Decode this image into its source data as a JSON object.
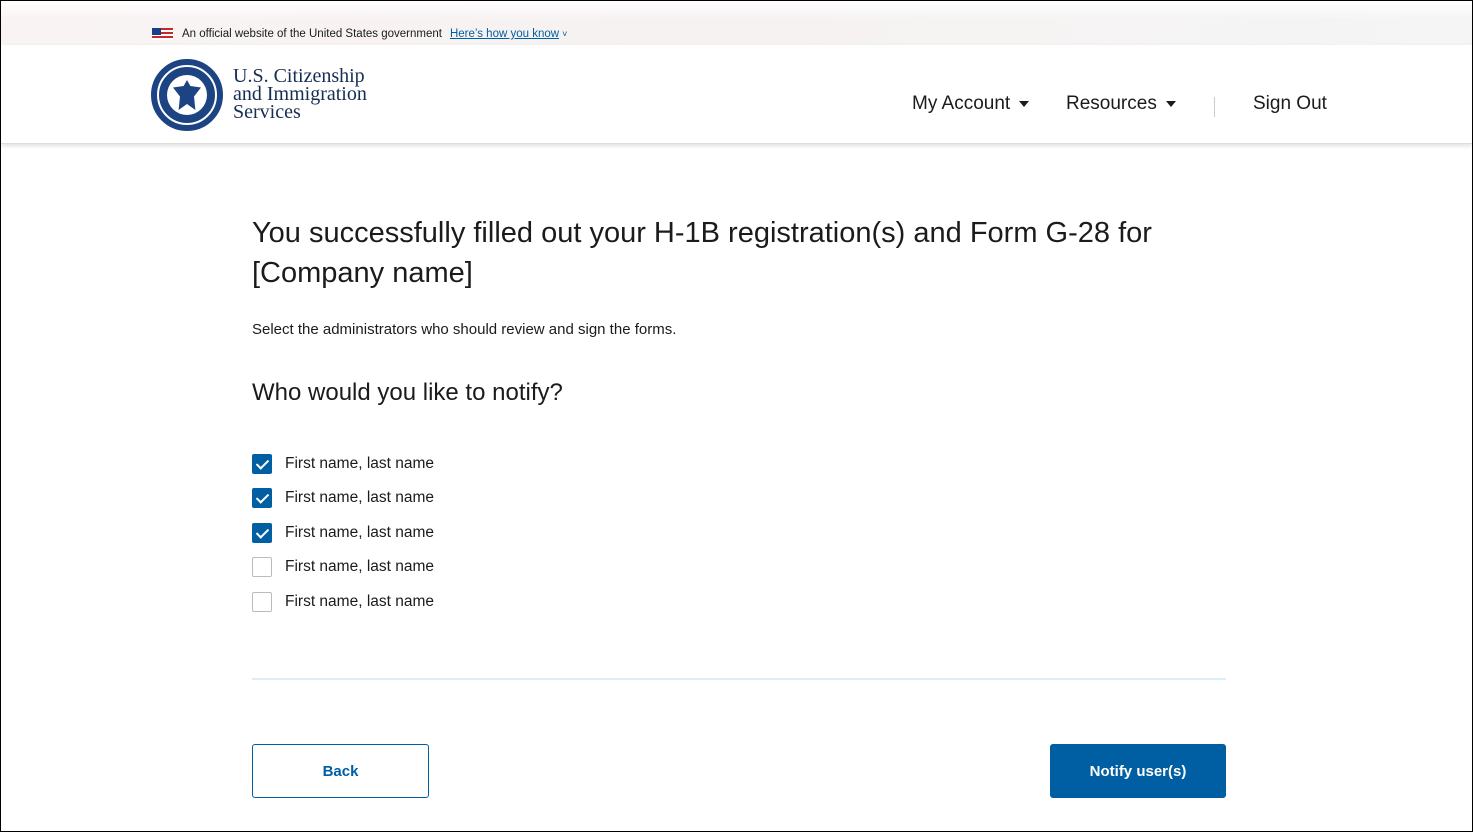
{
  "gov_banner": {
    "text": "An official website of the United States government",
    "link": "Here’s how you know",
    "chevron": "˅"
  },
  "header": {
    "agency_lines": [
      "U.S. Citizenship",
      "and Immigration",
      "Services"
    ],
    "seal_icon": "dhs-seal-icon"
  },
  "nav": {
    "my_account": "My Account",
    "resources": "Resources",
    "sign_out": "Sign Out"
  },
  "main": {
    "title": "You successfully filled out your H-1B registration(s) and Form G-28 for [Company name]",
    "subtitle": "Select the administrators who should review and sign the forms.",
    "question": "Who would you like to notify?",
    "users": [
      {
        "label": "First name, last name",
        "checked": true
      },
      {
        "label": "First name, last name",
        "checked": true
      },
      {
        "label": "First name, last name",
        "checked": true
      },
      {
        "label": "First name, last name",
        "checked": false
      },
      {
        "label": "First name, last name",
        "checked": false
      }
    ]
  },
  "actions": {
    "back": "Back",
    "notify": "Notify user(s)"
  },
  "colors": {
    "primary": "#005ea2",
    "agency_text": "#162e51",
    "divider": "#d9eef8"
  }
}
